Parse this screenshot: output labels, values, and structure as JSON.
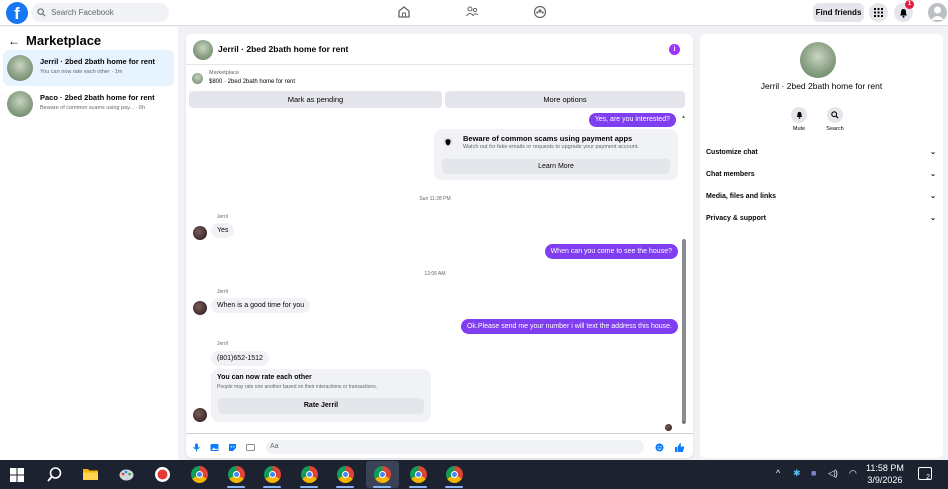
{
  "topbar": {
    "search_placeholder": "Search Facebook",
    "find_friends": "Find friends",
    "notification_count": "1"
  },
  "sidebar": {
    "title": "Marketplace",
    "conversations": [
      {
        "name": "Jerril · 2bed 2bath home for rent",
        "snippet": "You can now rate each other · 1m",
        "active": true
      },
      {
        "name": "Paco · 2bed 2bath home for rent",
        "snippet": "Beware of common scams using pay... · 6h",
        "active": false
      }
    ]
  },
  "chat": {
    "title": "Jerril · 2bed 2bath home for rent",
    "marketplace_label": "Marketplace",
    "listing": "$800 · 2bed 2bath home for rent",
    "mark_pending": "Mark as pending",
    "more_options": "More options",
    "messages": {
      "m1": "Yes, are you interested?",
      "scam_title": "Beware of common scams using payment apps",
      "scam_sub": "Watch out for fake emails or requests to upgrade your payment account.",
      "learn_more": "Learn More",
      "time1": "Sun 11:28 PM",
      "sender": "Jerril",
      "m2": "Yes",
      "m3": "When can you come to see the house?",
      "time2": "12:06 AM",
      "m4": "When is a good time for you",
      "m5": "Ok.Please send me your number i will text the address this house.",
      "m6": "(801)652-1512",
      "rate_title": "You can now rate each other",
      "rate_sub": "People may rate one another based on their interactions or transactions.",
      "rate_button": "Rate Jerril"
    },
    "input_placeholder": "Aa"
  },
  "right_panel": {
    "title": "Jerril · 2bed 2bath home for rent",
    "mute": "Mute",
    "search": "Search",
    "sections": [
      "Customize chat",
      "Chat members",
      "Media, files and links",
      "Privacy & support"
    ]
  },
  "taskbar": {
    "time": "11:58 PM",
    "date": "3/9/2026",
    "notif": "2"
  },
  "colors": {
    "brand": "#1877f2",
    "outgoing_bubble": "#7f3ff0"
  }
}
